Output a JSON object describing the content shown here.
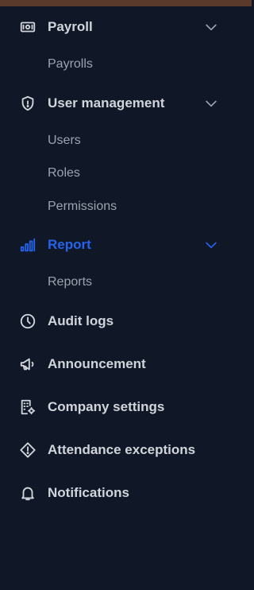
{
  "colors": {
    "background": "#101828",
    "text": "#d1d5db",
    "sub_text": "#9ca3af",
    "active": "#2563eb",
    "top_strip": "#5a3a2a"
  },
  "sidebar": {
    "payroll": {
      "label": "Payroll",
      "icon": "banknote-icon",
      "expanded": true,
      "children": [
        "Payrolls"
      ]
    },
    "user_management": {
      "label": "User management",
      "icon": "shield-icon",
      "expanded": true,
      "children": [
        "Users",
        "Roles",
        "Permissions"
      ]
    },
    "report": {
      "label": "Report",
      "icon": "bar-chart-icon",
      "active": true,
      "expanded": true,
      "children": [
        "Reports"
      ]
    },
    "audit_logs": {
      "label": "Audit logs",
      "icon": "clock-icon"
    },
    "announcement": {
      "label": "Announcement",
      "icon": "megaphone-icon"
    },
    "company_settings": {
      "label": "Company settings",
      "icon": "building-settings-icon"
    },
    "attendance_exceptions": {
      "label": "Attendance exceptions",
      "icon": "alert-diamond-icon"
    },
    "notifications": {
      "label": "Notifications",
      "icon": "bell-icon"
    }
  }
}
